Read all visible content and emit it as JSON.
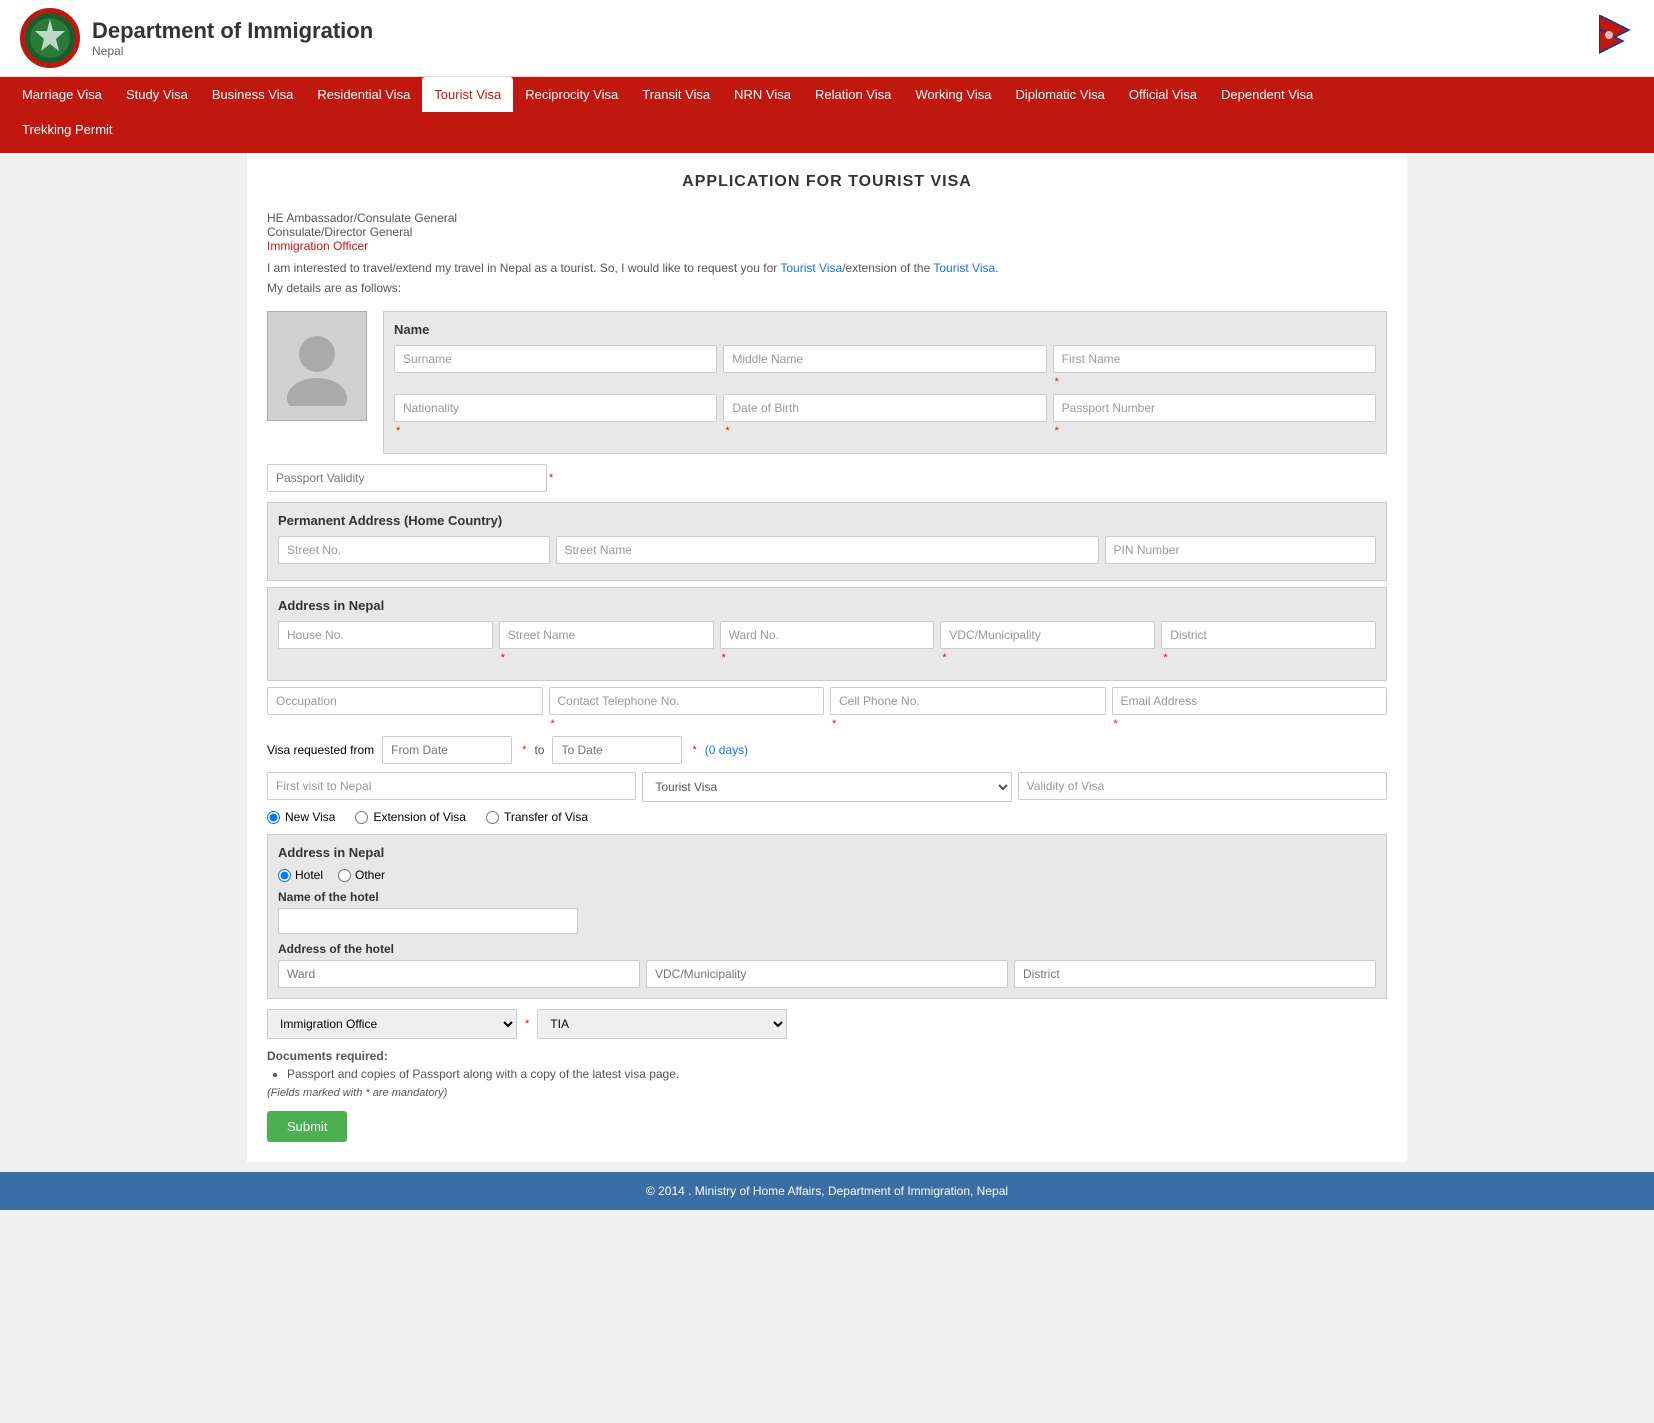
{
  "header": {
    "title": "Department of Immigration",
    "subtitle": "Nepal",
    "flag_alt": "Nepal Flag"
  },
  "nav": {
    "items": [
      {
        "label": "Marriage Visa",
        "active": false
      },
      {
        "label": "Study Visa",
        "active": false
      },
      {
        "label": "Business Visa",
        "active": false
      },
      {
        "label": "Residential Visa",
        "active": false
      },
      {
        "label": "Tourist Visa",
        "active": true
      },
      {
        "label": "Reciprocity Visa",
        "active": false
      },
      {
        "label": "Transit Visa",
        "active": false
      },
      {
        "label": "NRN Visa",
        "active": false
      },
      {
        "label": "Relation Visa",
        "active": false
      },
      {
        "label": "Working Visa",
        "active": false
      },
      {
        "label": "Diplomatic Visa",
        "active": false
      },
      {
        "label": "Official Visa",
        "active": false
      },
      {
        "label": "Dependent Visa",
        "active": false
      }
    ],
    "second_row": [
      {
        "label": "Trekking Permit",
        "active": false
      }
    ]
  },
  "page_title": "APPLICATION FOR TOURIST VISA",
  "intro": {
    "line1": "HE Ambassador/Consulate General",
    "line2": "Consulate/Director General",
    "line3_link": "Immigration Officer",
    "para": "I am interested to travel/extend my travel in Nepal as a tourist. So, I would like to request you for Tourist Visa/extension of the Tourist Visa.",
    "para_link1": "Tourist Visa",
    "para_link2": "Tourist Visa",
    "my_details": "My details are as follows:"
  },
  "name_section": {
    "title": "Name",
    "surname_placeholder": "Surname",
    "middle_name_placeholder": "Middle Name",
    "first_name_placeholder": "First Name"
  },
  "personal_fields": {
    "nationality_placeholder": "Nationality",
    "dob_placeholder": "Date of Birth",
    "passport_number_placeholder": "Passport Number",
    "passport_validity_placeholder": "Passport Validity"
  },
  "permanent_address": {
    "title": "Permanent Address (Home Country)",
    "street_no_placeholder": "Street No.",
    "street_name_placeholder": "Street Name",
    "pin_number_placeholder": "PIN Number"
  },
  "address_nepal": {
    "title": "Address in Nepal",
    "house_no_placeholder": "House No.",
    "street_name_placeholder": "Street Name",
    "ward_no_placeholder": "Ward No.",
    "vdc_placeholder": "VDC/Municipality",
    "district_placeholder": "District"
  },
  "contact_section": {
    "occupation_placeholder": "Occupation",
    "contact_tel_placeholder": "Contact Telephone No.",
    "cell_phone_placeholder": "Cell Phone No.",
    "email_placeholder": "Email Address"
  },
  "visa_dates": {
    "label": "Visa requested from",
    "from_date_placeholder": "From Date",
    "to_label": "to",
    "to_date_placeholder": "To Date",
    "days_label": "(0 days)"
  },
  "visit_section": {
    "first_visit_placeholder": "First visit to Nepal",
    "visa_type_options": [
      "Tourist Visa"
    ],
    "visa_type_selected": "Tourist Visa",
    "validity_placeholder": "Validity of Visa"
  },
  "visa_type_radios": {
    "new_visa_label": "New Visa",
    "extension_label": "Extension of Visa",
    "transfer_label": "Transfer of Visa"
  },
  "hotel_section": {
    "title": "Address in Nepal",
    "hotel_label": "Hotel",
    "other_label": "Other",
    "name_label": "Name of the hotel",
    "address_label": "Address of the hotel",
    "ward_placeholder": "Ward",
    "vdc_placeholder": "VDC/Municipality",
    "district_placeholder": "District"
  },
  "immigration_office": {
    "office_options": [
      "Immigration Office"
    ],
    "office_selected": "Immigration Office",
    "tia_options": [
      "TIA"
    ],
    "tia_selected": "TIA"
  },
  "documents": {
    "title": "Documents required:",
    "items": [
      "Passport and copies of Passport along with a copy of the latest visa page."
    ],
    "mandatory_note": "(Fields marked with * are mandatory)"
  },
  "submit_button": "Submit",
  "footer": {
    "text": "© 2014 . Ministry of Home Affairs, Department of Immigration, Nepal"
  }
}
